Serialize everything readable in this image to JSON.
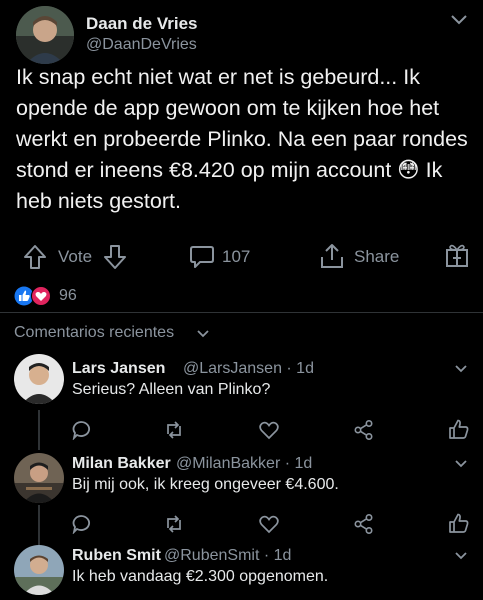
{
  "post": {
    "author_name": "Daan de Vries",
    "author_handle": "@DaanDeVries",
    "text": "Ik snap echt niet wat er net is gebeurd... Ik opende de app gewoon om te kijken hoe het werkt en probeerde Plinko. Na een paar rondes stond er ineens €8.420 op mijn account 😳 Ik heb niets gestort.",
    "actions": {
      "vote_label": "Vote",
      "comments_count": "107",
      "share_label": "Share"
    },
    "reactions_count": "96",
    "icons": [
      "chevron-down-icon",
      "arrow-up-icon",
      "arrow-down-icon",
      "comment-icon",
      "share-icon",
      "gift-icon",
      "like-icon",
      "heart-icon"
    ]
  },
  "comments_section": {
    "header": "Comentarios recientes",
    "items": [
      {
        "name": "Lars Jansen",
        "meta": "@LarsJansen · 1d",
        "text": "Serieus? Alleen van Plinko?"
      },
      {
        "name": "Milan Bakker",
        "meta": "@MilanBakker · 1d",
        "text": "Bij mij ook, ik kreeg ongeveer €4.600."
      },
      {
        "name": "Ruben Smit",
        "meta": "@RubenSmit · 1d",
        "text": "Ik heb vandaag €2.300 opgenomen."
      }
    ]
  },
  "colors": {
    "background": "#000000",
    "text": "#e7e9ea",
    "muted": "#8b949e",
    "like_blue": "#1877f2",
    "heart_red": "#e0245e"
  }
}
